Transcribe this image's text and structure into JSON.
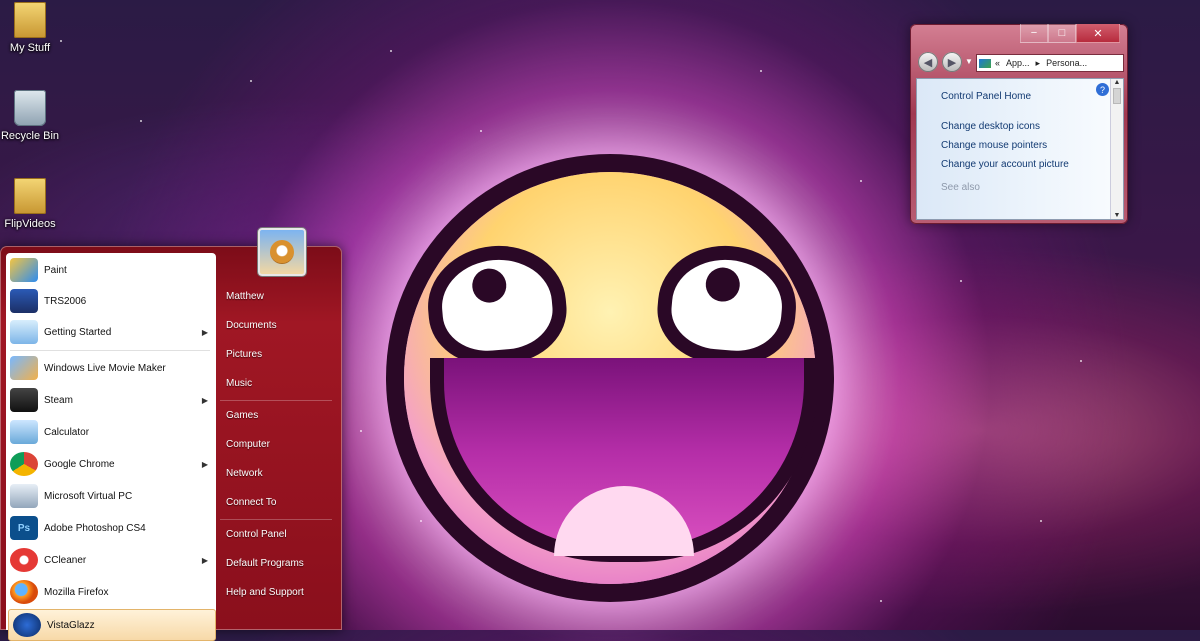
{
  "desktop": {
    "icons": [
      {
        "label": "My Stuff"
      },
      {
        "label": "Recycle Bin"
      },
      {
        "label": "FlipVideos"
      }
    ]
  },
  "start_menu": {
    "left_items": [
      {
        "label": "Paint",
        "has_arrow": false
      },
      {
        "label": "TRS2006",
        "has_arrow": false
      },
      {
        "label": "Getting Started",
        "has_arrow": true
      },
      {
        "label": "Windows Live Movie Maker",
        "has_arrow": false
      },
      {
        "label": "Steam",
        "has_arrow": true
      },
      {
        "label": "Calculator",
        "has_arrow": false
      },
      {
        "label": "Google Chrome",
        "has_arrow": true
      },
      {
        "label": "Microsoft Virtual PC",
        "has_arrow": false
      },
      {
        "label": "Adobe Photoshop CS4",
        "has_arrow": false
      },
      {
        "label": "CCleaner",
        "has_arrow": true
      },
      {
        "label": "Mozilla Firefox",
        "has_arrow": false
      },
      {
        "label": "VistaGlazz",
        "has_arrow": false,
        "selected": true
      }
    ],
    "right_items": [
      {
        "label": "Matthew"
      },
      {
        "label": "Documents"
      },
      {
        "label": "Pictures"
      },
      {
        "label": "Music"
      },
      {
        "label": "Games"
      },
      {
        "label": "Computer"
      },
      {
        "label": "Network"
      },
      {
        "label": "Connect To"
      },
      {
        "label": "Control Panel"
      },
      {
        "label": "Default Programs"
      },
      {
        "label": "Help and Support"
      }
    ]
  },
  "control_panel": {
    "breadcrumb": [
      "App...",
      "Persona..."
    ],
    "links": [
      "Control Panel Home",
      "Change desktop icons",
      "Change mouse pointers",
      "Change your account picture"
    ],
    "see_also": "See also"
  },
  "colors": {
    "start_menu_bg": "#8a0f1c",
    "selection": "#f7d9a8",
    "window_frame": "#b95d73"
  },
  "icons": {
    "back": "back-arrow-icon",
    "forward": "forward-arrow-icon",
    "help": "help-icon"
  }
}
